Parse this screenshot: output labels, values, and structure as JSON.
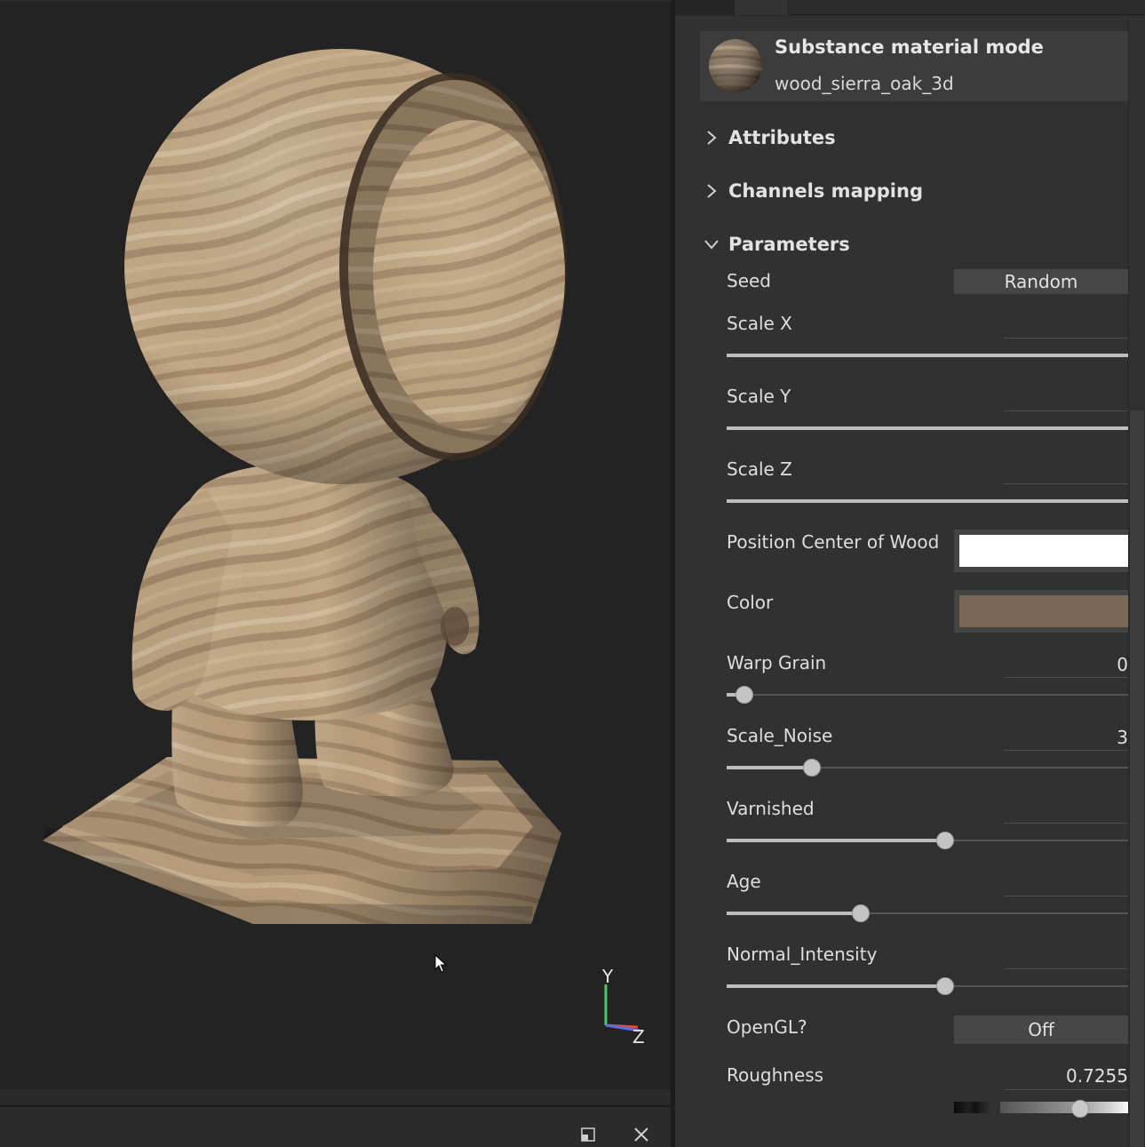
{
  "viewport": {
    "axis": {
      "y": "Y",
      "z": "Z"
    }
  },
  "material": {
    "title": "Substance material mode",
    "name": "wood_sierra_oak_3d"
  },
  "sections": {
    "attributes": "Attributes",
    "channels": "Channels mapping",
    "parameters": "Parameters"
  },
  "params": {
    "seed": {
      "label": "Seed",
      "button": "Random"
    },
    "scale_x": {
      "label": "Scale X",
      "value": "",
      "fraction": 1.0
    },
    "scale_y": {
      "label": "Scale Y",
      "value": "",
      "fraction": 1.0
    },
    "scale_z": {
      "label": "Scale Z",
      "value": "",
      "fraction": 1.0
    },
    "position_center": {
      "label": "Position Center of Wood",
      "color": "#ffffff"
    },
    "color": {
      "label": "Color",
      "color": "#7a6756"
    },
    "warp_grain": {
      "label": "Warp Grain",
      "value": "0",
      "fraction": 0.044
    },
    "scale_noise": {
      "label": "Scale_Noise",
      "value": "3",
      "fraction": 0.212
    },
    "varnished": {
      "label": "Varnished",
      "value": "",
      "fraction": 0.545
    },
    "age": {
      "label": "Age",
      "value": "",
      "fraction": 0.334
    },
    "normal_intensity": {
      "label": "Normal_Intensity",
      "value": "",
      "fraction": 0.545
    },
    "opengl": {
      "label": "OpenGL?",
      "button": "Off"
    },
    "roughness": {
      "label": "Roughness",
      "value": "0.7255"
    }
  },
  "colors": {
    "panel_bg": "#313131",
    "viewport_bg": "#232323",
    "wood_light": "#c6ad8c",
    "wood_dark": "#8c7358"
  }
}
